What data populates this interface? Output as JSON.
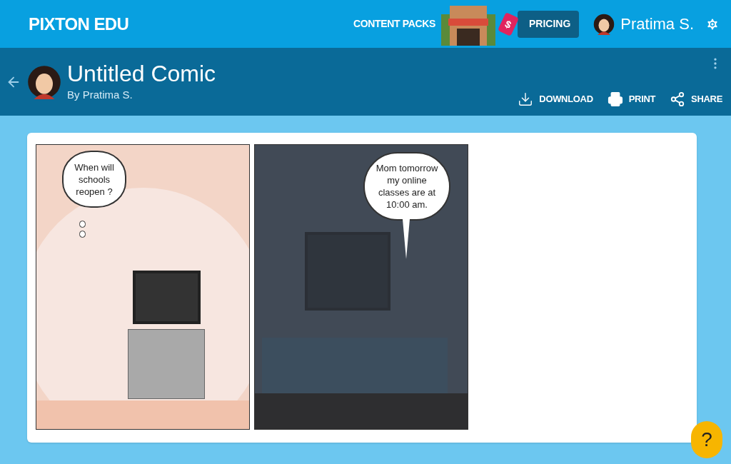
{
  "topbar": {
    "logo": "PIXTON EDU",
    "content_packs": "CONTENT PACKS",
    "pricing": "PRICING",
    "pricing_tag": "$",
    "user": "Pratima S."
  },
  "header": {
    "title": "Untitled Comic",
    "byline": "By Pratima S.",
    "actions": [
      {
        "kind": "download",
        "label": "DOWNLOAD"
      },
      {
        "kind": "print",
        "label": "PRINT"
      },
      {
        "kind": "share",
        "label": "SHARE"
      }
    ]
  },
  "panels": [
    {
      "kind": "thought",
      "dark": false,
      "text": "When will schools reopen ?"
    },
    {
      "kind": "speech",
      "dark": true,
      "text": "Mom tomorrow my online classes are at 10:00 am."
    }
  ],
  "help": "?"
}
